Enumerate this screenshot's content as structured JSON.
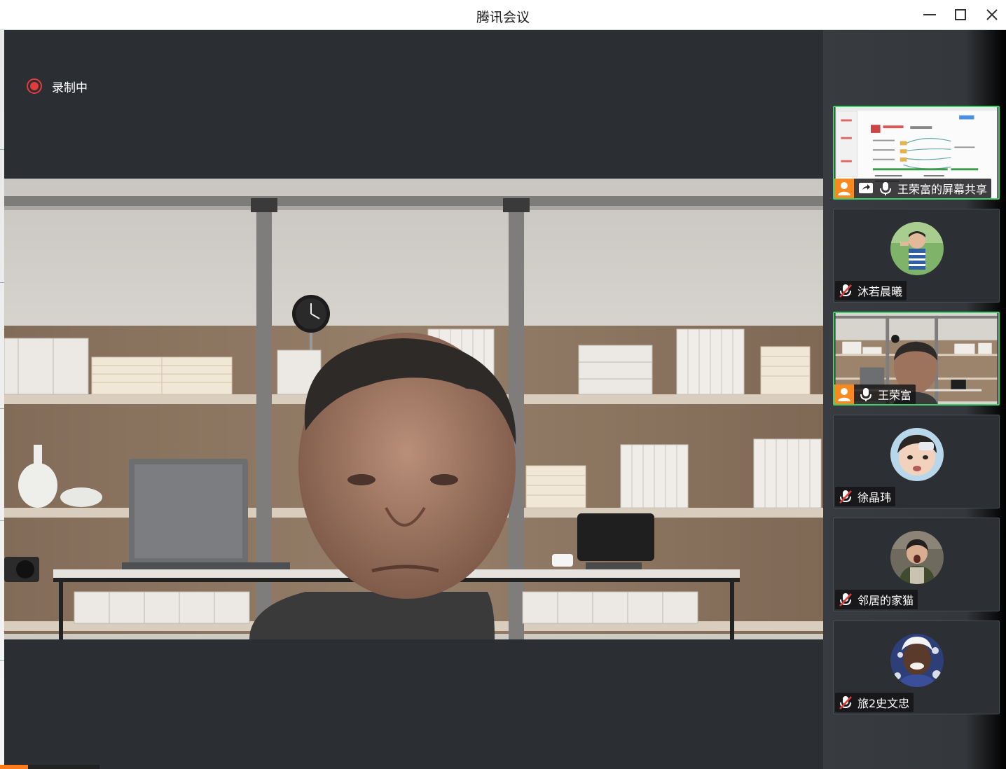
{
  "window": {
    "title": "腾讯会议",
    "controls": [
      "minimize-icon",
      "maximize-icon",
      "close-icon"
    ]
  },
  "recording": {
    "label": "录制中",
    "color": "#e23b3b"
  },
  "participants": [
    {
      "name": "王荣富的屏幕共享",
      "type": "screen-share",
      "active": true,
      "host": true,
      "mic": "on"
    },
    {
      "name": "沐若晨曦",
      "type": "avatar",
      "active": false,
      "host": false,
      "mic": "muted"
    },
    {
      "name": "王荣富",
      "type": "video",
      "active": true,
      "host": true,
      "mic": "on"
    },
    {
      "name": "徐晶玮",
      "type": "avatar",
      "active": false,
      "host": false,
      "mic": "muted"
    },
    {
      "name": "邻居的家猫",
      "type": "avatar",
      "active": false,
      "host": false,
      "mic": "muted"
    },
    {
      "name": "旅2史文忠",
      "type": "avatar",
      "active": false,
      "host": false,
      "mic": "muted"
    }
  ],
  "colors": {
    "accent_active": "#3fd16b",
    "host_badge": "#f7891f",
    "muted": "#e23b3b"
  }
}
